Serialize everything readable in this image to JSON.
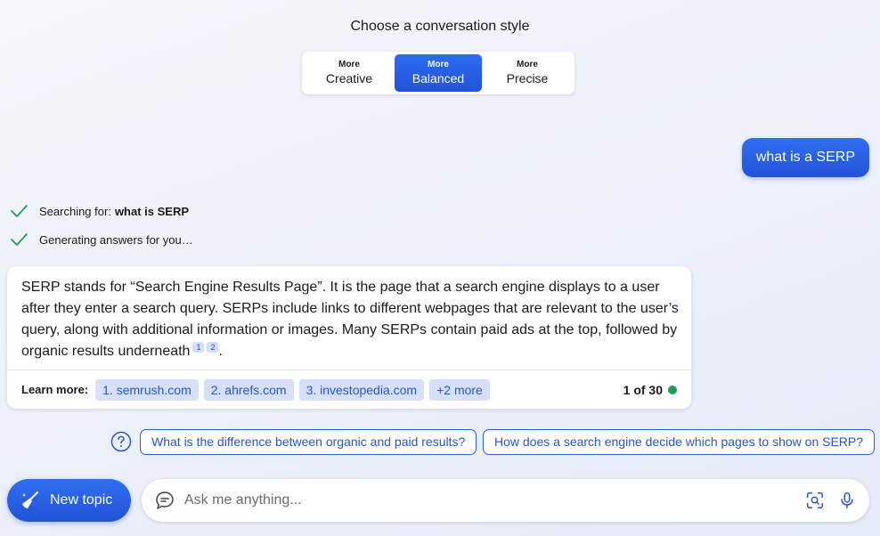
{
  "header": {
    "title": "Choose a conversation style",
    "styles": [
      {
        "prefix": "More",
        "label": "Creative",
        "active": false
      },
      {
        "prefix": "More",
        "label": "Balanced",
        "active": true
      },
      {
        "prefix": "More",
        "label": "Precise",
        "active": false
      }
    ]
  },
  "user_message": "what is a SERP",
  "status": {
    "searching_prefix": "Searching for:",
    "searching_query": "what is SERP",
    "generating": "Generating answers for you…"
  },
  "answer": {
    "text": "SERP stands for “Search Engine Results Page”. It is the page that a search engine displays to a user after they enter a search query. SERPs include links to different webpages that are relevant to the user’s query, along with additional information or images. Many SERPs contain paid ads at the top, followed by organic results underneath",
    "citations": [
      "1",
      "2"
    ],
    "end": ".",
    "learn_more_label": "Learn more:",
    "sources": [
      "1. semrush.com",
      "2. ahrefs.com",
      "3. investopedia.com",
      "+2 more"
    ],
    "count": "1 of 30",
    "count_color": "#1f9e57"
  },
  "suggestions": [
    "What is the difference between organic and paid results?",
    "How does a search engine decide which pages to show on SERP?"
  ],
  "bottom": {
    "new_topic_label": "New topic",
    "input_placeholder": "Ask me anything...",
    "input_value": ""
  },
  "colors": {
    "accent": "#2b6cf0",
    "chip_bg": "#d6e0fb",
    "check": "#1f9e57"
  }
}
